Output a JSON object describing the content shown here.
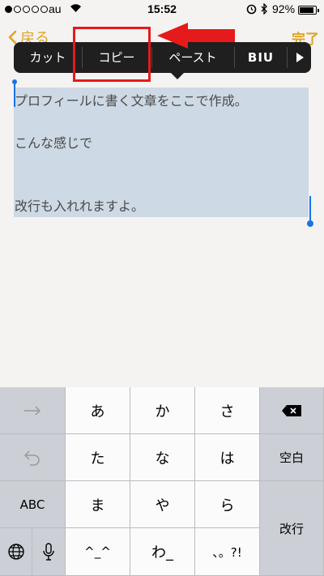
{
  "status_bar": {
    "carrier": "au",
    "time": "15:52",
    "battery": "92%"
  },
  "nav": {
    "back": "戻る",
    "done": "完了"
  },
  "edit_menu": {
    "cut": "カット",
    "copy": "コピー",
    "paste": "ペースト",
    "format": "BIU"
  },
  "note": {
    "lines": [
      "プロフィールに書く文章をここで作成。",
      "",
      "こんな感じで",
      "",
      "",
      "改行も入れれますよ。"
    ]
  },
  "keyboard": {
    "row1": [
      "あ",
      "か",
      "さ"
    ],
    "row2": [
      "た",
      "な",
      "は"
    ],
    "row3": [
      "ま",
      "や",
      "ら"
    ],
    "row4": [
      "^_^",
      "わ_",
      "、。?!"
    ],
    "abc": "ABC",
    "space": "空白",
    "return": "改行"
  },
  "colors": {
    "accent": "#e1a325",
    "highlight_box": "#e51a1a",
    "selection": "#cdd9e4",
    "handle": "#1a73e8"
  }
}
